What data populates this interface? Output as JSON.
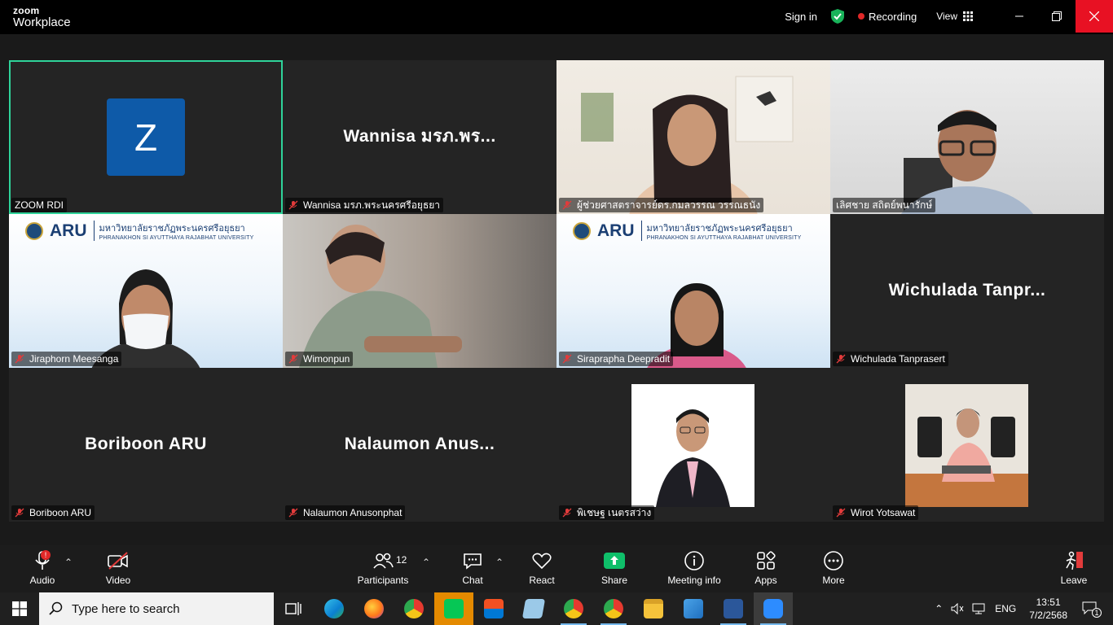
{
  "app": {
    "brand_top": "zoom",
    "brand_bottom": "Workplace"
  },
  "titlebar": {
    "signin": "Sign in",
    "recording": "Recording",
    "view": "View"
  },
  "tiles": [
    {
      "big": "",
      "avatar_letter": "Z",
      "label": "ZOOM RDI",
      "muted": false
    },
    {
      "big": "Wannisa มรภ.พร...",
      "label": "Wannisa มรภ.พระนครศรีอยุธยา",
      "muted": true
    },
    {
      "big": "",
      "label": "ผู้ช่วยศาสตราจารย์ดร.กมลวรรณ วรรณธนัง",
      "muted": true
    },
    {
      "big": "",
      "label": "เลิศชาย สถิตย์พนารักษ์",
      "muted": false
    },
    {
      "big": "",
      "label": "Jiraphorn Meesanga",
      "muted": true
    },
    {
      "big": "",
      "label": "Wimonpun",
      "muted": true
    },
    {
      "big": "",
      "label": "Siraprapha Deepradit",
      "muted": true
    },
    {
      "big": "Wichulada  Tanpr...",
      "label": "Wichulada Tanprasert",
      "muted": true
    },
    {
      "big": "Boriboon ARU",
      "label": "Boriboon ARU",
      "muted": true
    },
    {
      "big": "Nalaumon  Anus...",
      "label": "Nalaumon Anusonphat",
      "muted": true
    },
    {
      "big": "",
      "label": "พิเชษฐ เนตรสว่าง",
      "muted": true
    },
    {
      "big": "",
      "label": "Wirot Yotsawat",
      "muted": true
    }
  ],
  "aru_banner": {
    "short": "ARU",
    "thai": "มหาวิทยาลัยราชภัฏพระนครศรีอยุธยา",
    "english": "PHRANAKHON SI AYUTTHAYA RAJABHAT UNIVERSITY"
  },
  "toolbar": {
    "audio": "Audio",
    "audio_badge": "!",
    "video": "Video",
    "participants": "Participants",
    "participants_count": "12",
    "chat": "Chat",
    "react": "React",
    "share": "Share",
    "meeting_info": "Meeting info",
    "apps": "Apps",
    "more": "More",
    "leave": "Leave"
  },
  "taskbar": {
    "search_placeholder": "Type here to search",
    "lang": "ENG",
    "time": "13:51",
    "date": "7/2/2568",
    "notif_count": "1"
  },
  "colors": {
    "active_border": "#2fd39a",
    "recording": "#e02828",
    "share": "#0fbf6a",
    "close": "#e81123"
  }
}
